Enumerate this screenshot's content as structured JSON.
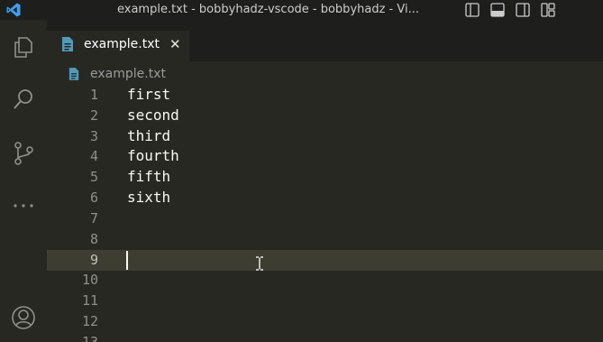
{
  "window": {
    "title": "example.txt - bobbyhadz-vscode - bobbyhadz - Vi..."
  },
  "tab": {
    "filename": "example.txt",
    "close_glyph": "✕"
  },
  "breadcrumb": {
    "filename": "example.txt"
  },
  "editor": {
    "lines": [
      {
        "number": "1",
        "text": "first"
      },
      {
        "number": "2",
        "text": "second"
      },
      {
        "number": "3",
        "text": "third"
      },
      {
        "number": "4",
        "text": "fourth"
      },
      {
        "number": "5",
        "text": "fifth"
      },
      {
        "number": "6",
        "text": "sixth"
      },
      {
        "number": "7",
        "text": ""
      },
      {
        "number": "8",
        "text": ""
      },
      {
        "number": "9",
        "text": ""
      },
      {
        "number": "10",
        "text": ""
      },
      {
        "number": "11",
        "text": ""
      },
      {
        "number": "12",
        "text": ""
      },
      {
        "number": "13",
        "text": ""
      }
    ],
    "current_line": "9"
  },
  "activity_bar": {
    "items": [
      "explorer-icon",
      "search-icon",
      "source-control-icon",
      "more-icon"
    ],
    "bottom": [
      "account-icon"
    ]
  },
  "colors": {
    "editor_bg": "#272822",
    "titlebar_bg": "#1e1f1c",
    "line_highlight": "#3e3d32",
    "file_icon": "#519aba",
    "vscode_blue": "#3aa0f3"
  }
}
